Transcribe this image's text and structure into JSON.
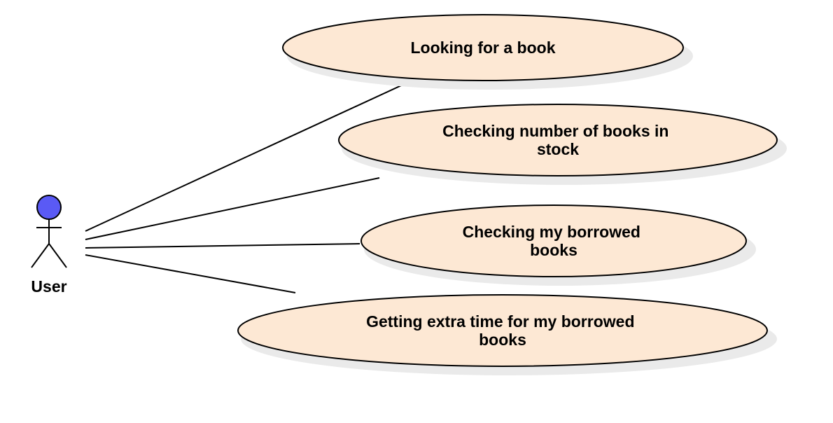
{
  "colors": {
    "usecase_fill": "#fde8d4",
    "shadow": "#eaeaea",
    "actor_head": "#5a5af5",
    "line": "#000000"
  },
  "actor": {
    "label": "User"
  },
  "use_cases": [
    {
      "id": "looking-for-book",
      "lines": [
        "Looking for a book"
      ]
    },
    {
      "id": "checking-stock",
      "lines": [
        "Checking number of books in",
        "stock"
      ]
    },
    {
      "id": "checking-borrowed",
      "lines": [
        "Checking my borrowed",
        "books"
      ]
    },
    {
      "id": "extra-time",
      "lines": [
        "Getting extra time for my borrowed",
        "books"
      ]
    }
  ]
}
